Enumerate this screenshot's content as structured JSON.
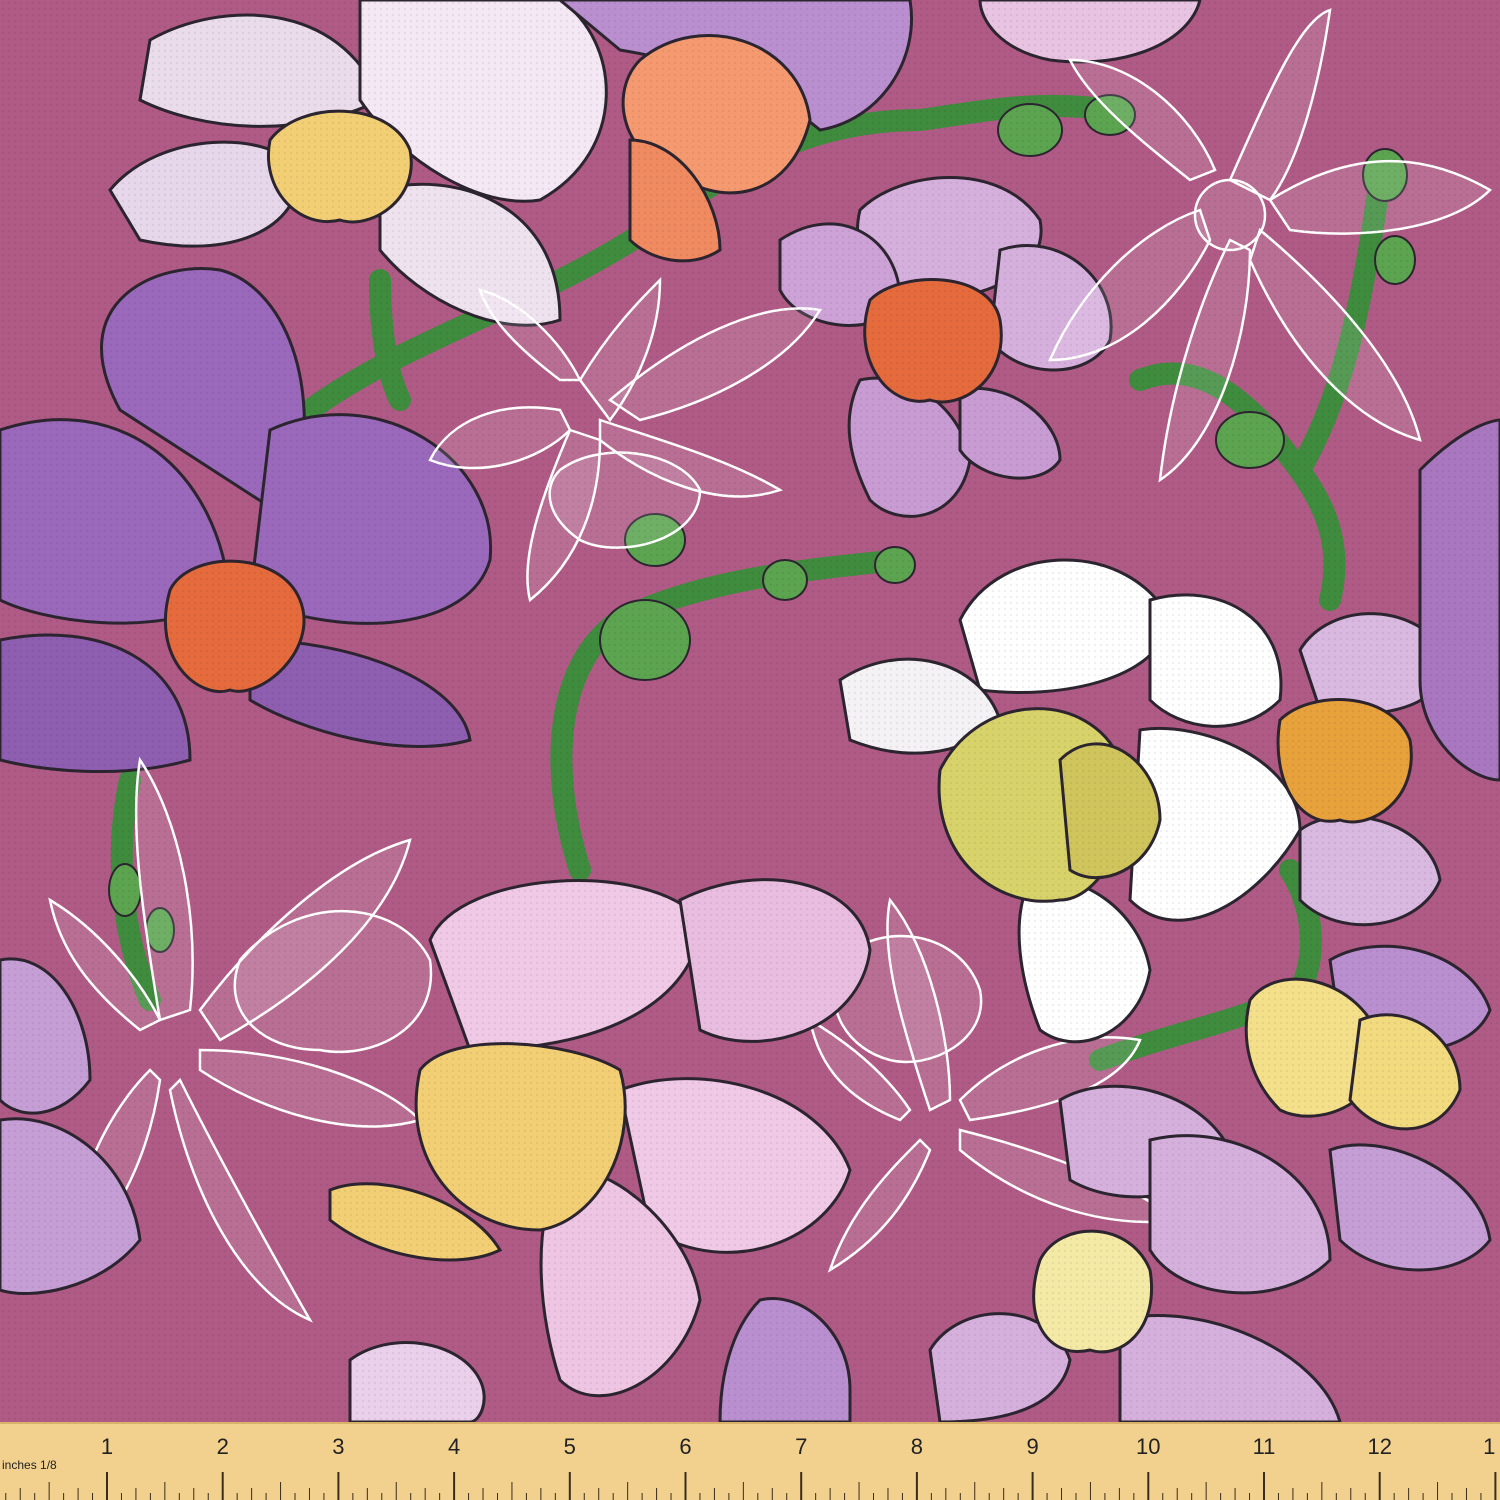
{
  "image": {
    "background_color": "#b05a86",
    "motif": "hand-drawn orchid and daffodil pattern on mauve pink fabric",
    "palette": {
      "stem": "#3f8c3e",
      "purple_petal": "#9a69bb",
      "lavender_petal": "#d6b0dd",
      "light_petal": "#f2ddf0",
      "white_petal": "#ffffff",
      "orange_center": "#e56b3d",
      "peach_center": "#f59a70",
      "yellow_center": "#f2cf74",
      "olive_center": "#d8d26a",
      "outline": "#2c2530",
      "white_outline": "#ffffff"
    }
  },
  "ruler": {
    "unit_label": "inches 1/8",
    "numbers": [
      "1",
      "2",
      "3",
      "4",
      "5",
      "6",
      "7",
      "8",
      "9",
      "10",
      "11",
      "12",
      "1"
    ],
    "color": "#f2d18e"
  }
}
